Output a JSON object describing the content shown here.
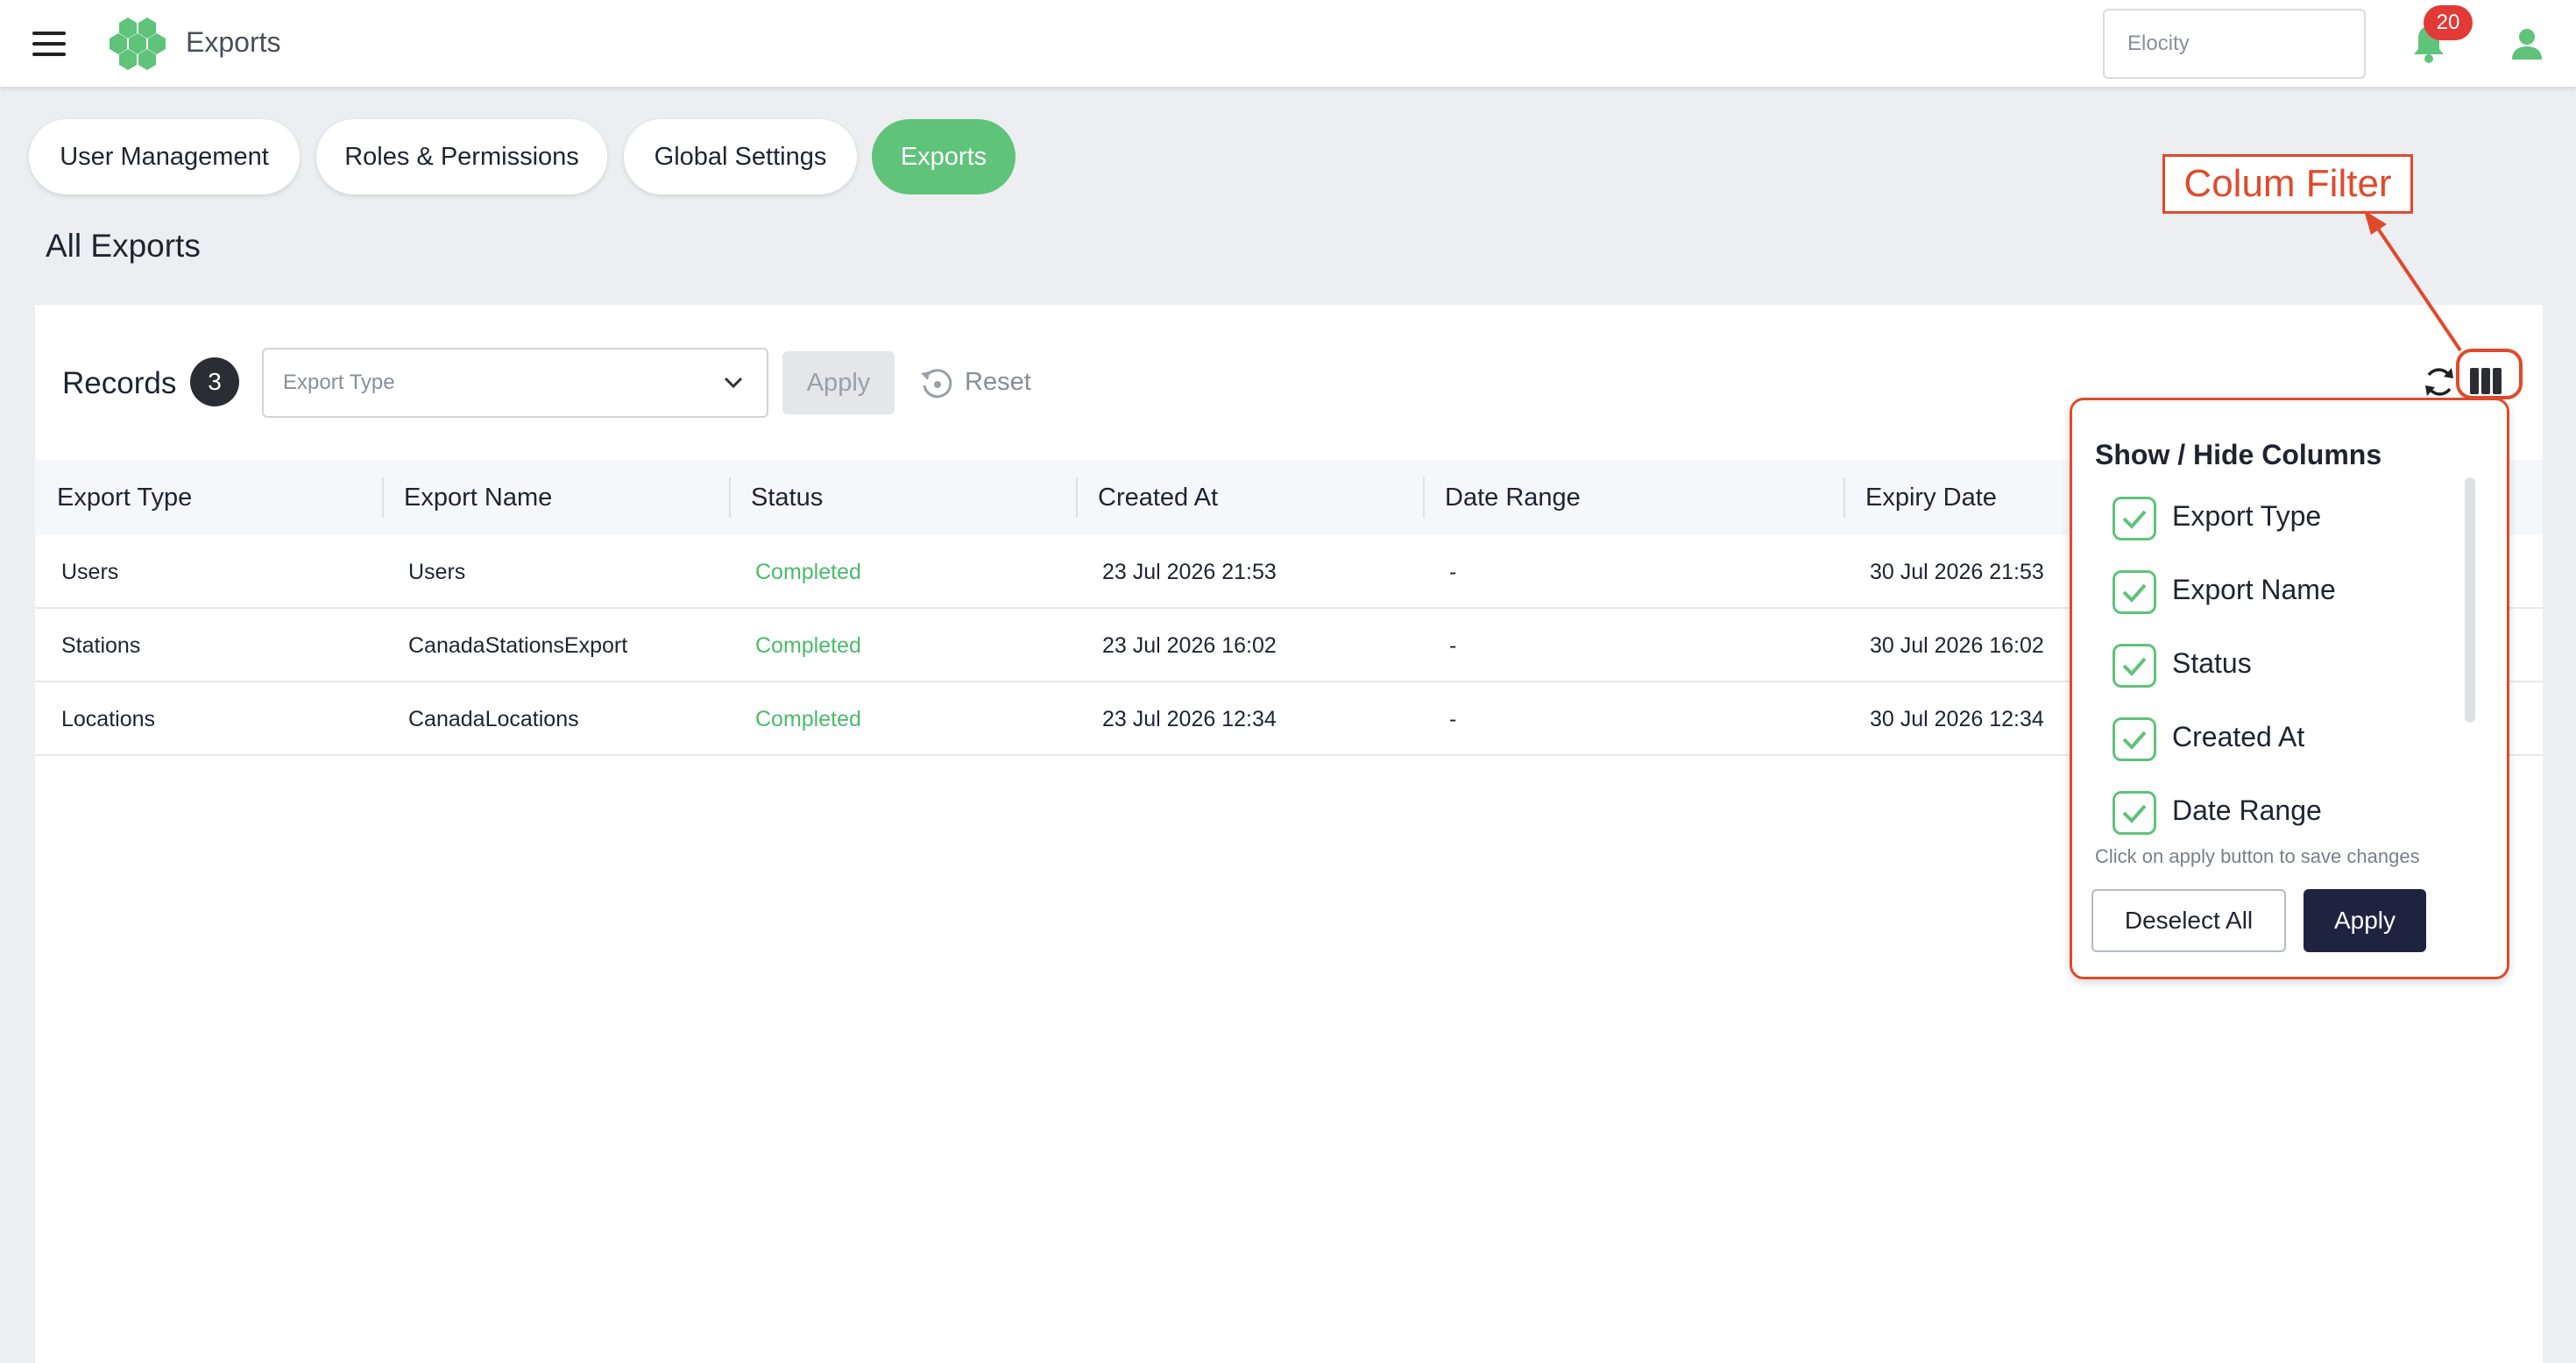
{
  "header": {
    "app_title": "Exports",
    "org_select_value": "Elocity",
    "notification_count": "20"
  },
  "tabs": [
    {
      "label": "User Management",
      "active": false
    },
    {
      "label": "Roles & Permissions",
      "active": false
    },
    {
      "label": "Global Settings",
      "active": false
    },
    {
      "label": "Exports",
      "active": true
    }
  ],
  "page": {
    "title": "All Exports"
  },
  "toolbar": {
    "records_label": "Records",
    "records_count": "3",
    "export_type_placeholder": "Export Type",
    "apply_label": "Apply",
    "reset_label": "Reset"
  },
  "table": {
    "columns": [
      "Export Type",
      "Export Name",
      "Status",
      "Created At",
      "Date Range",
      "Expiry Date"
    ],
    "rows": [
      {
        "export_type": "Users",
        "export_name": "Users",
        "status": "Completed",
        "created_at": "23 Jul 2026 21:53",
        "date_range": "-",
        "expiry_date": "30 Jul 2026 21:53"
      },
      {
        "export_type": "Stations",
        "export_name": "CanadaStationsExport",
        "status": "Completed",
        "created_at": "23 Jul 2026 16:02",
        "date_range": "-",
        "expiry_date": "30 Jul 2026 16:02"
      },
      {
        "export_type": "Locations",
        "export_name": "CanadaLocations",
        "status": "Completed",
        "created_at": "23 Jul 2026 12:34",
        "date_range": "-",
        "expiry_date": "30 Jul 2026 12:34"
      }
    ]
  },
  "annotation": {
    "label": "Colum Filter",
    "color": "#e04a2a"
  },
  "column_popup": {
    "title": "Show / Hide Columns",
    "options": [
      {
        "label": "Export Type",
        "checked": true
      },
      {
        "label": "Export Name",
        "checked": true
      },
      {
        "label": "Status",
        "checked": true
      },
      {
        "label": "Created At",
        "checked": true
      },
      {
        "label": "Date Range",
        "checked": true
      }
    ],
    "hint": "Click on apply button to save changes",
    "deselect_label": "Deselect All",
    "apply_label": "Apply"
  },
  "colors": {
    "accent_green": "#5fc37a",
    "status_green": "#4cbb6c",
    "primary_dark": "#1e2440",
    "badge_red": "#e23a36"
  },
  "icons": [
    "menu-icon",
    "logo-icon",
    "bell-icon",
    "user-icon",
    "chevron-down-icon",
    "reset-icon",
    "refresh-icon",
    "columns-icon",
    "check-icon"
  ]
}
